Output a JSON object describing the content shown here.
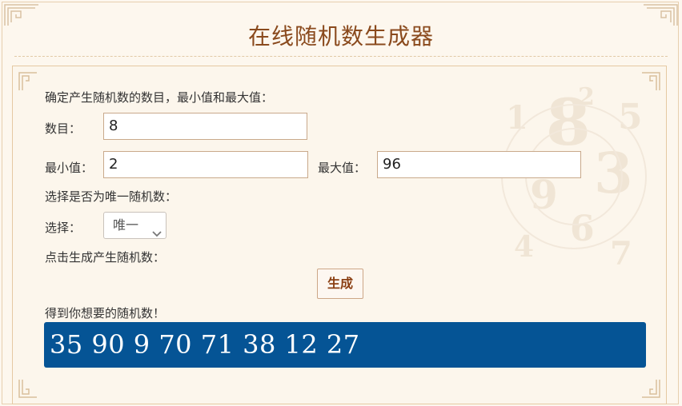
{
  "title": "在线随机数生成器",
  "instructions": {
    "count_intro": "确定产生随机数的数目，最小值和最大值：",
    "unique_intro": "选择是否为唯一随机数：",
    "generate_intro": "点击生成产生随机数：",
    "result_intro": "得到你想要的随机数！"
  },
  "count": {
    "label": "数目：",
    "value": "8"
  },
  "min": {
    "label": "最小值：",
    "value": "2"
  },
  "max": {
    "label": "最大值：",
    "value": "96"
  },
  "unique": {
    "label": "选择：",
    "selected": "唯一"
  },
  "generate_button": "生成",
  "result": {
    "text": "35  90  9  70  71  38  12  27"
  },
  "colors": {
    "title": "#8a4a1d",
    "result_background": "#055495",
    "button_text": "#8a3e12",
    "page_background": "#fdf7ef"
  }
}
